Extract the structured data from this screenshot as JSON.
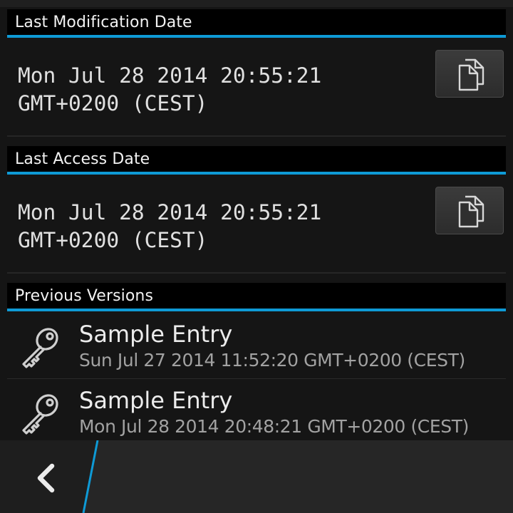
{
  "sections": {
    "last_modification": {
      "header": "Last Modification Date",
      "value_line1": "Mon Jul 28 2014 20:55:21",
      "value_line2": "GMT+0200 (CEST)",
      "copy_icon": "copy-icon"
    },
    "last_access": {
      "header": "Last Access Date",
      "value_line1": "Mon Jul 28 2014 20:55:21",
      "value_line2": "GMT+0200 (CEST)",
      "copy_icon": "copy-icon"
    },
    "previous_versions": {
      "header": "Previous Versions",
      "items": [
        {
          "icon": "key-icon",
          "title": "Sample Entry",
          "subtitle": "Sun Jul 27 2014 11:52:20 GMT+0200 (CEST)"
        },
        {
          "icon": "key-icon",
          "title": "Sample Entry",
          "subtitle": "Mon Jul 28 2014 20:48:21 GMT+0200 (CEST)"
        }
      ]
    }
  },
  "action_bar": {
    "back_icon": "chevron-left-icon"
  },
  "colors": {
    "accent": "#0e9ad6",
    "header_bg": "#000000",
    "background": "#151515",
    "action_bar_bg": "#1a1a1a",
    "text_primary": "#e6e6e6",
    "text_secondary": "#a2a2a2"
  }
}
